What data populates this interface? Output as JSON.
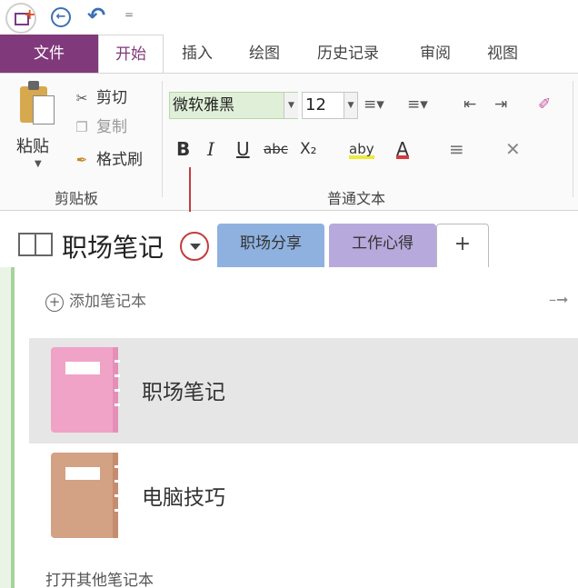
{
  "qat": {
    "app_icon": "onenote-new-page-icon",
    "back_icon": "back-arrow-icon",
    "undo_icon": "undo-icon",
    "more_label": "="
  },
  "ribbon_tabs": {
    "file": "文件",
    "home": "开始",
    "insert": "插入",
    "draw": "绘图",
    "history": "历史记录",
    "review": "审阅",
    "view": "视图"
  },
  "clipboard": {
    "paste": "粘贴",
    "cut": "剪切",
    "copy": "复制",
    "format_painter": "格式刷",
    "group_label": "剪贴板"
  },
  "basic_text": {
    "font_name": "微软雅黑",
    "font_size": "12",
    "bold": "B",
    "italic": "I",
    "underline": "U",
    "strikethrough": "abc",
    "subscript": "X₂",
    "highlight": "aby",
    "font_color": "A",
    "group_label": "普通文本"
  },
  "notebook_bar": {
    "notebook_title": "职场笔记",
    "section_tabs": [
      "职场分享",
      "工作心得",
      "+"
    ]
  },
  "notebook_panel": {
    "add_notebook": "添加笔记本",
    "notebooks": [
      {
        "name": "职场笔记",
        "color": "#f1a2c7",
        "selected": true
      },
      {
        "name": "电脑技巧",
        "color": "#d3a184",
        "selected": false
      }
    ],
    "open_other": "打开其他笔记本"
  },
  "colors": {
    "accent": "#80397b",
    "annotation": "#c43c3c",
    "font_highlight": "#e0f0d8"
  }
}
